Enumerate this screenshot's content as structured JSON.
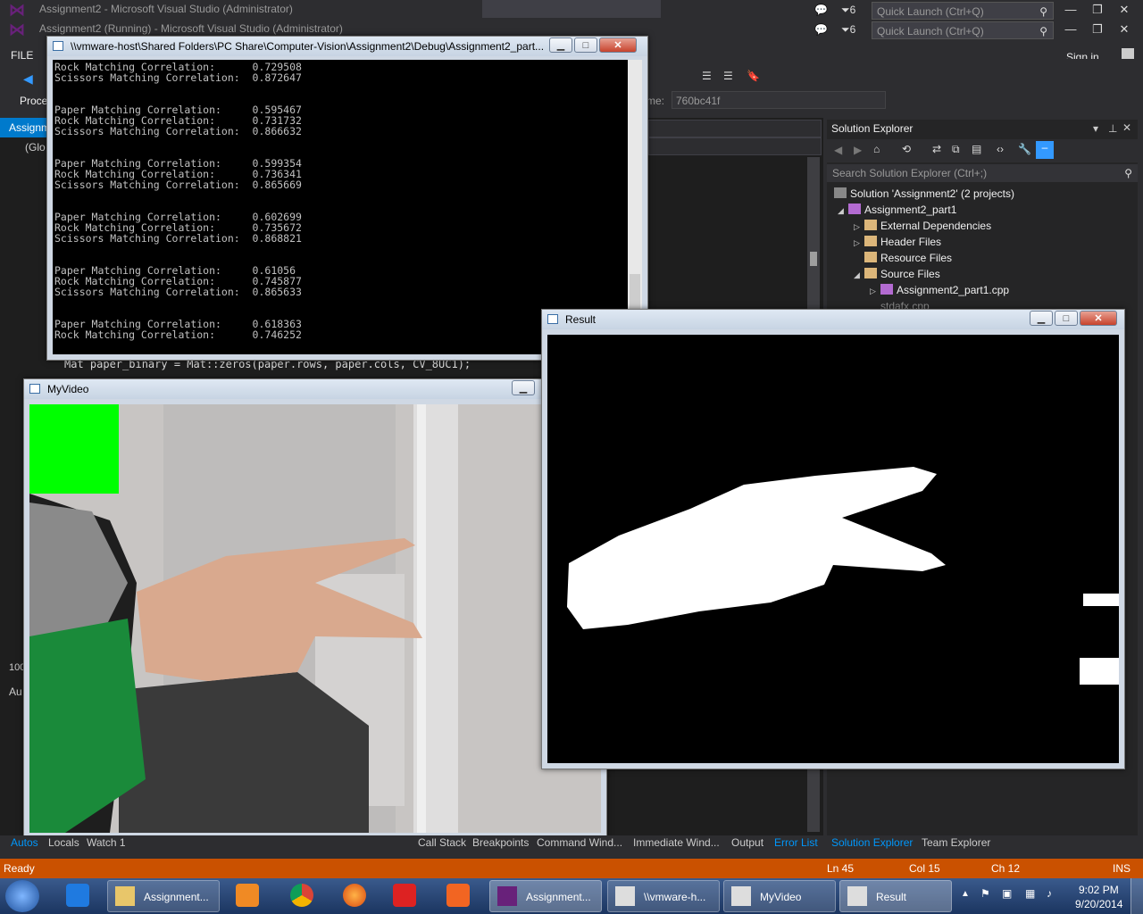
{
  "vs": {
    "title": "Assignment2 - Microsoft Visual Studio (Administrator)",
    "title_back": "Assignment2 (Running) - Microsoft Visual Studio (Administrator)",
    "notifications_count": "6",
    "quick_launch_placeholder": "Quick Launch (Ctrl+Q)",
    "menu_file": "FILE",
    "sign_in": "Sign in",
    "process_label": "Proce",
    "frame_value": "760bc41f",
    "frame_label": "me:",
    "editor_tab": "Assignm",
    "editor_scope": "(Glo",
    "code_line_1": "Mat paper_binary = Mat::zeros(paper.rows, paper.cols, CV_8UC1);",
    "zoom": "100",
    "left_panel_label": "Au"
  },
  "solution_explorer": {
    "title": "Solution Explorer",
    "search_placeholder": "Search Solution Explorer (Ctrl+;)",
    "items": [
      {
        "label": "Solution 'Assignment2' (2 projects)"
      },
      {
        "label": "Assignment2_part1"
      },
      {
        "label": "External Dependencies"
      },
      {
        "label": "Header Files"
      },
      {
        "label": "Resource Files"
      },
      {
        "label": "Source Files"
      },
      {
        "label": "Assignment2_part1.cpp"
      },
      {
        "label": "stdafx.cpp"
      }
    ]
  },
  "console_window": {
    "title": "\\\\vmware-host\\Shared Folders\\PC Share\\Computer-Vision\\Assignment2\\Debug\\Assignment2_part...",
    "lines": [
      "Rock Matching Correlation:      0.729508",
      "Scissors Matching Correlation:  0.872647",
      "",
      "Paper Matching Correlation:     0.595467",
      "Rock Matching Correlation:      0.731732",
      "Scissors Matching Correlation:  0.866632",
      "",
      "Paper Matching Correlation:     0.599354",
      "Rock Matching Correlation:      0.736341",
      "Scissors Matching Correlation:  0.865669",
      "",
      "Paper Matching Correlation:     0.602699",
      "Rock Matching Correlation:      0.735672",
      "Scissors Matching Correlation:  0.868821",
      "",
      "Paper Matching Correlation:     0.61056",
      "Rock Matching Correlation:      0.745877",
      "Scissors Matching Correlation:  0.865633",
      "",
      "Paper Matching Correlation:     0.618363",
      "Rock Matching Correlation:      0.746252"
    ]
  },
  "video_window": {
    "title": "MyVideo"
  },
  "result_window": {
    "title": "Result"
  },
  "bottom_tabs": {
    "left": [
      "Autos",
      "Locals",
      "Watch 1"
    ],
    "right": [
      "Call Stack",
      "Breakpoints",
      "Command Wind...",
      "Immediate Wind...",
      "Output",
      "Error List"
    ],
    "se_tabs": [
      "Solution Explorer",
      "Team Explorer"
    ]
  },
  "status_bar": {
    "state": "Ready",
    "line": "Ln 45",
    "col": "Col 15",
    "ch": "Ch 12",
    "mode": "INS"
  },
  "taskbar": {
    "buttons": [
      {
        "label": "Assignment..."
      },
      {
        "label": "Assignment..."
      },
      {
        "label": "\\\\vmware-h..."
      },
      {
        "label": "MyVideo"
      },
      {
        "label": "Result"
      }
    ],
    "time": "9:02 PM",
    "date": "9/20/2014"
  },
  "colors": {
    "status_bar": "#ca5100",
    "accent": "#007acc",
    "green_box": "#00ff00"
  }
}
